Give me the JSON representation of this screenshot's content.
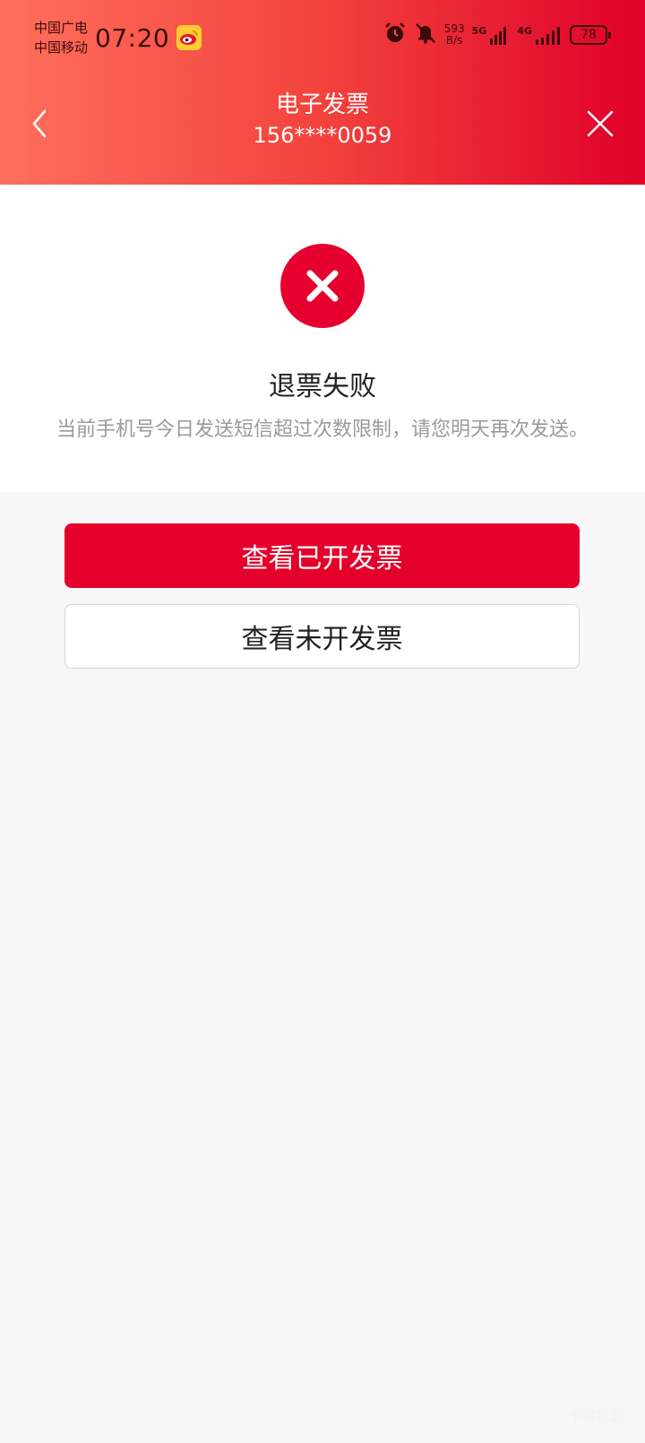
{
  "status_bar": {
    "carrier_1": "中国广电",
    "carrier_2": "中国移动",
    "time": "07:20",
    "net_speed_value": "593",
    "net_speed_unit": "B/s",
    "network_1": "5G",
    "network_2": "4G",
    "battery": "78"
  },
  "header": {
    "title": "电子发票",
    "subtitle": "156****0059"
  },
  "result": {
    "title": "退票失败",
    "description": "当前手机号今日发送短信超过次数限制，请您明天再次发送。"
  },
  "buttons": {
    "view_issued": "查看已开发票",
    "view_unissued": "查看未开发票"
  },
  "watermark": "卡农社区",
  "colors": {
    "accent": "#e5002c",
    "header_gradient_start": "#ff6f5c",
    "header_gradient_end": "#e0002a"
  }
}
